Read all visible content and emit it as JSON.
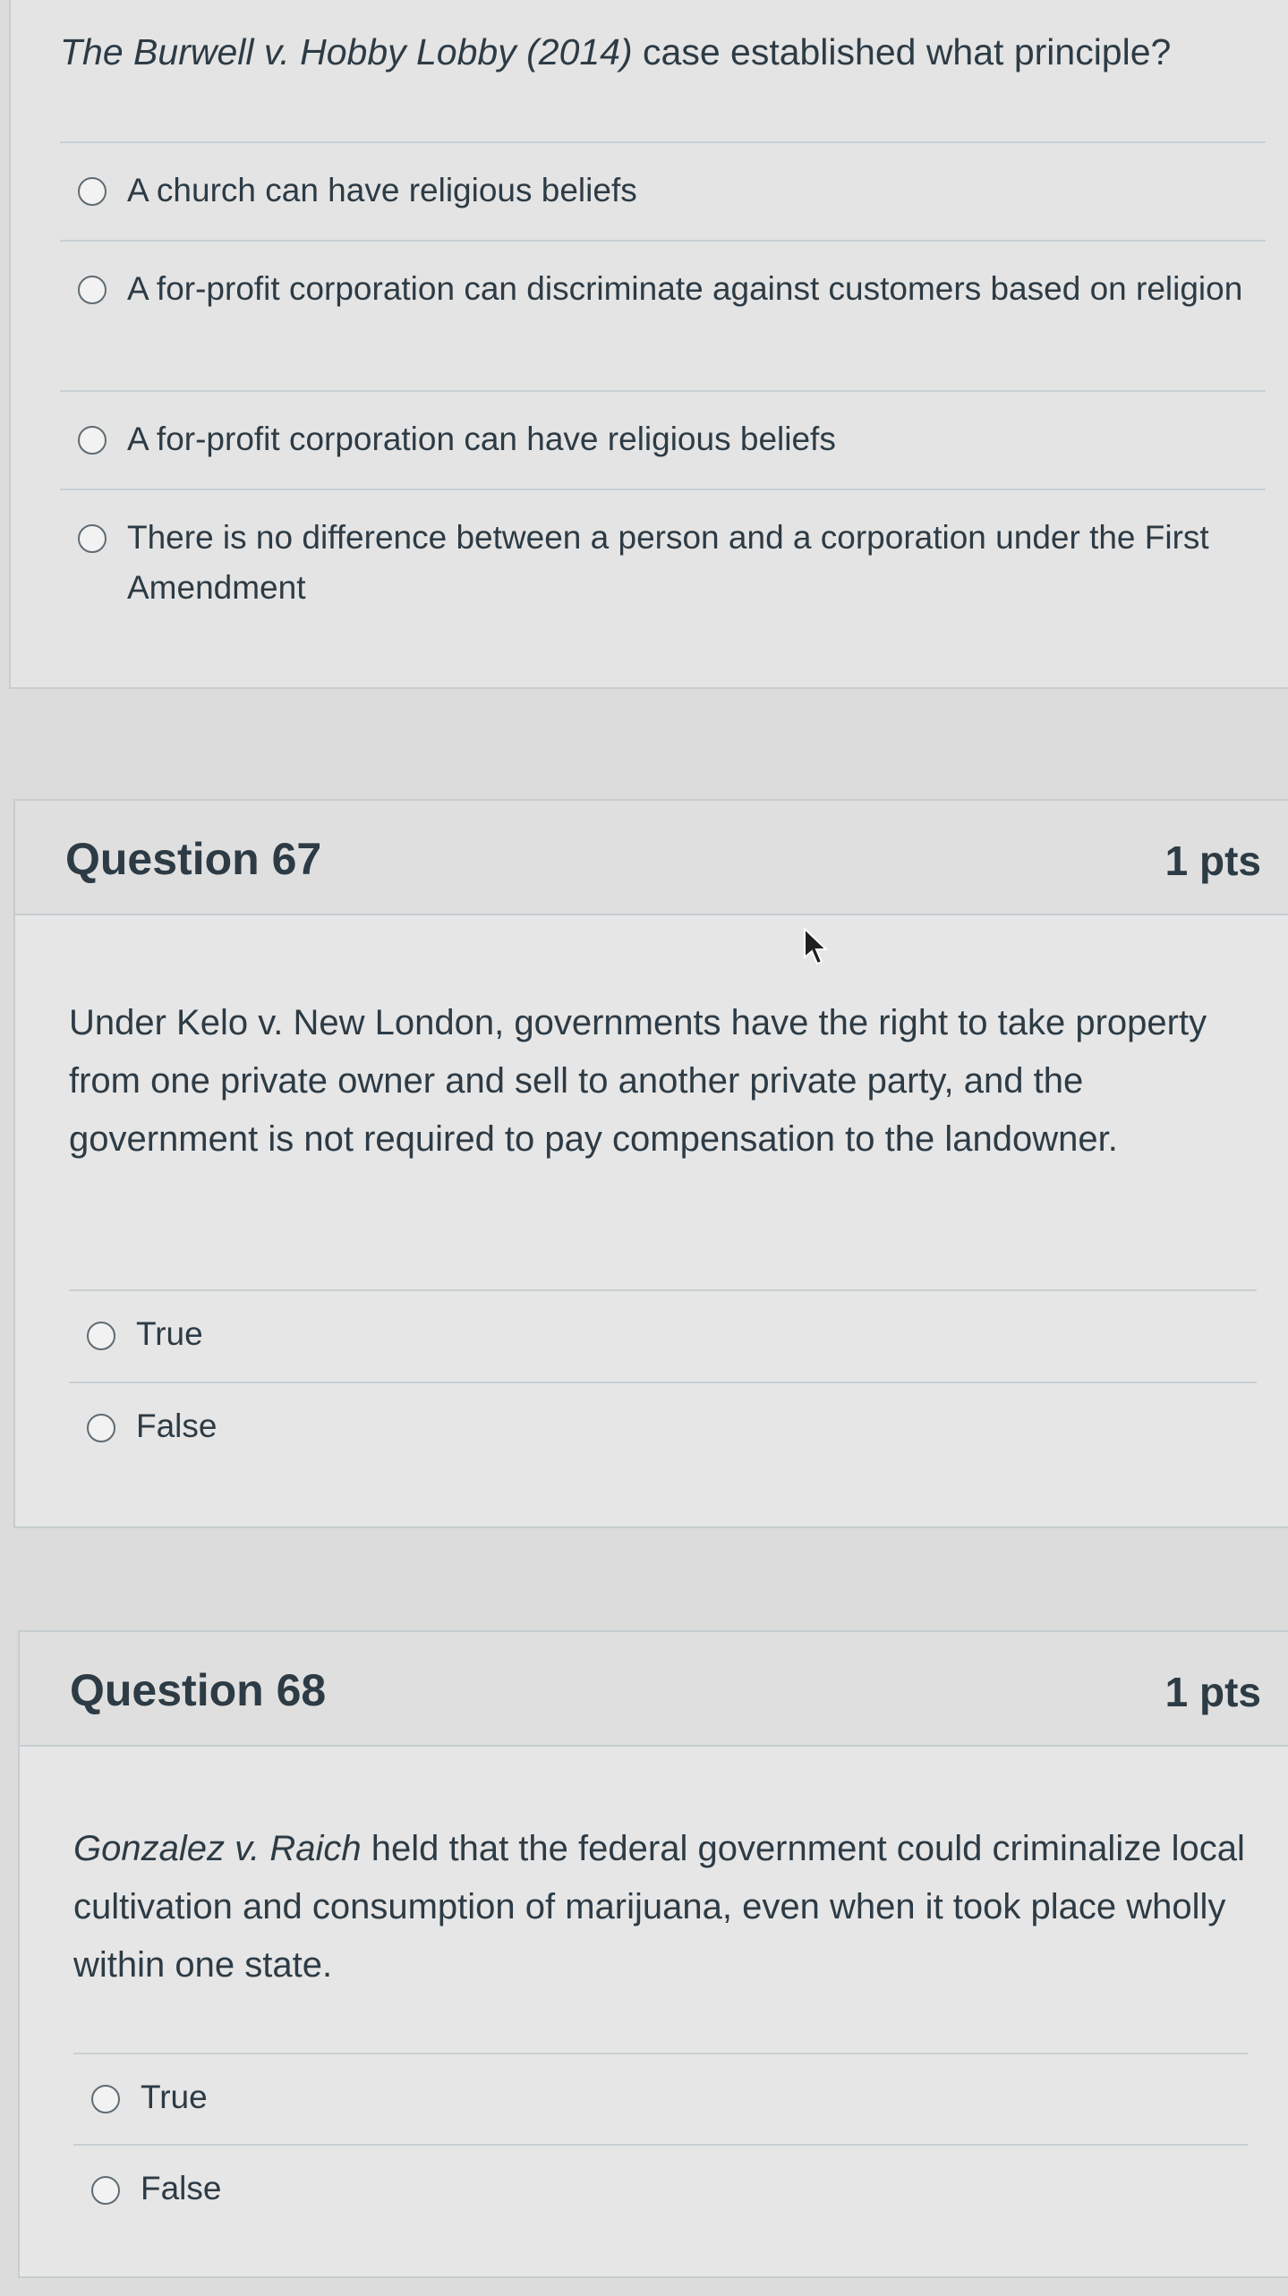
{
  "question66": {
    "text_italic": "The Burwell v. Hobby Lobby (2014)",
    "text_rest": " case established what principle?",
    "answers": [
      "A church can have religious beliefs",
      "A for-profit corporation can discriminate against customers based on religion",
      "A for-profit corporation can have religious beliefs",
      "There is no difference between a person and a corporation under the First Amendment"
    ]
  },
  "question67": {
    "title": "Question 67",
    "points": "1 pts",
    "text": "Under Kelo v. New London, governments have the right to take property from one private owner and sell to another private party, and the government is not required to pay compensation to the landowner.",
    "answers": [
      "True",
      "False"
    ]
  },
  "question68": {
    "title": "Question 68",
    "points": "1 pts",
    "text_italic": "Gonzalez v. Raich",
    "text_rest": " held that the federal government could criminalize local cultivation and consumption of marijuana, even when it took place wholly within one state.",
    "answers": [
      "True",
      "False"
    ]
  },
  "icons": {
    "radio": "radio-button-icon",
    "cursor": "mouse-cursor-icon"
  }
}
